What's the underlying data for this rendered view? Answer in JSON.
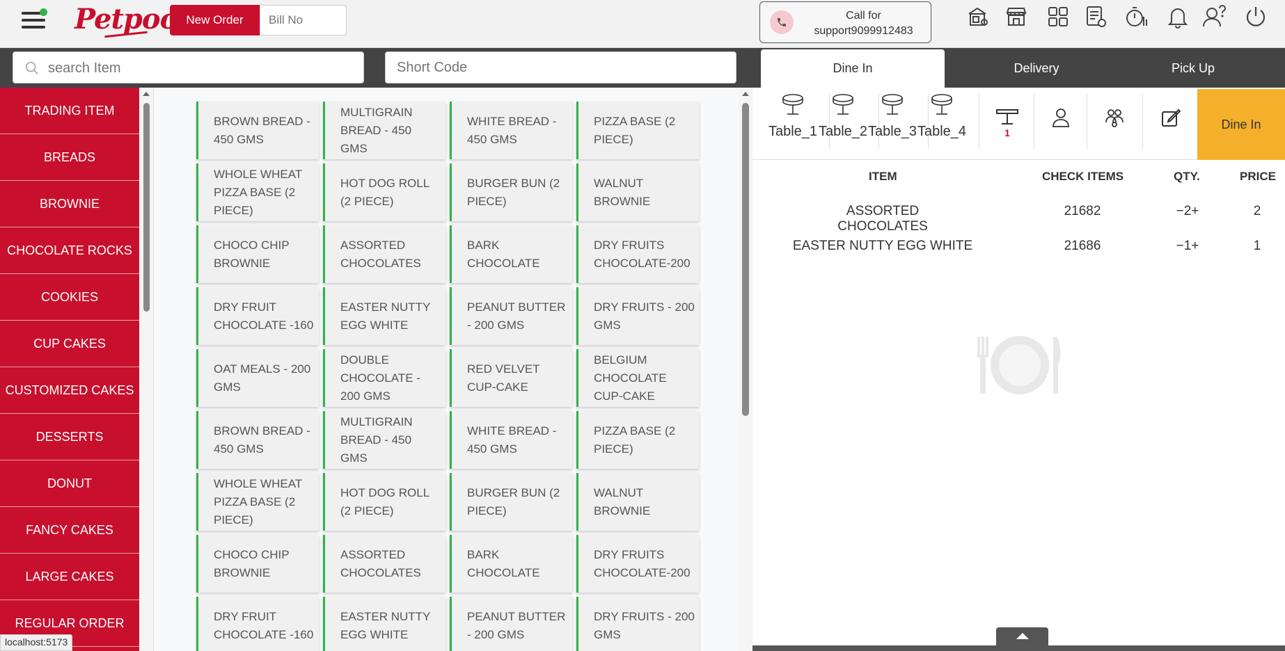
{
  "header": {
    "logo_text": "Petpooja",
    "new_order_label": "New Order",
    "bill_no_placeholder": "Bill No",
    "support_line1": "Call for",
    "support_line2": "support9099912483"
  },
  "search": {
    "item_placeholder": "search Item",
    "shortcode_placeholder": "Short Code"
  },
  "categories": [
    "TRADING ITEM",
    "BREADS",
    "BROWNIE",
    "CHOCOLATE ROCKS",
    "COOKIES",
    "CUP CAKES",
    "CUSTOMIZED CAKES",
    "DESSERTS",
    "DONUT",
    "FANCY CAKES",
    "LARGE CAKES",
    "REGULAR ORDER"
  ],
  "items": [
    "BROWN BREAD - 450 GMS",
    "MULTIGRAIN BREAD - 450 GMS",
    "WHITE BREAD - 450 GMS",
    "PIZZA BASE (2 PIECE)",
    "WHOLE WHEAT PIZZA BASE (2 PIECE)",
    "HOT DOG ROLL (2 PIECE)",
    "BURGER BUN (2 PIECE)",
    "WALNUT BROWNIE",
    "CHOCO CHIP BROWNIE",
    "ASSORTED CHOCOLATES",
    "BARK CHOCOLATE",
    "DRY FRUITS CHOCOLATE-200",
    "DRY FRUIT CHOCOLATE -160",
    "EASTER NUTTY EGG WHITE",
    "PEANUT BUTTER - 200 GMS",
    "DRY FRUITS - 200 GMS",
    "OAT MEALS - 200 GMS",
    "DOUBLE CHOCOLATE - 200 GMS",
    "RED VELVET CUP-CAKE",
    "BELGIUM CHOCOLATE CUP-CAKE",
    "BROWN BREAD - 450 GMS",
    "MULTIGRAIN BREAD - 450 GMS",
    "WHITE BREAD - 450 GMS",
    "PIZZA BASE (2 PIECE)",
    "WHOLE WHEAT PIZZA BASE (2 PIECE)",
    "HOT DOG ROLL (2 PIECE)",
    "BURGER BUN (2 PIECE)",
    "WALNUT BROWNIE",
    "CHOCO CHIP BROWNIE",
    "ASSORTED CHOCOLATES",
    "BARK CHOCOLATE",
    "DRY FRUITS CHOCOLATE-200",
    "DRY FRUIT CHOCOLATE -160",
    "EASTER NUTTY EGG WHITE",
    "PEANUT BUTTER - 200 GMS",
    "DRY FRUITS - 200 GMS"
  ],
  "order_tabs": [
    "Dine In",
    "Delivery",
    "Pick Up"
  ],
  "tables": [
    "Table_1",
    "Table_2",
    "Table_3",
    "Table_4"
  ],
  "table_badge": "1",
  "dine_in_button": "Dine In",
  "cart": {
    "headers": {
      "item": "ITEM",
      "check": "CHECK ITEMS",
      "qty": "QTY.",
      "price": "PRICE"
    },
    "rows": [
      {
        "item": "ASSORTED CHOCOLATES",
        "check": "21682",
        "qty": "2",
        "price": "2"
      },
      {
        "item": "EASTER NUTTY EGG WHITE",
        "check": "21686",
        "qty": "1",
        "price": "1"
      }
    ]
  },
  "status_url": "localhost:5173",
  "colors": {
    "brand": "#c8102e",
    "accent_green": "#2fb34a",
    "dine_in": "#f4b02a",
    "dark_bar": "#444444"
  }
}
